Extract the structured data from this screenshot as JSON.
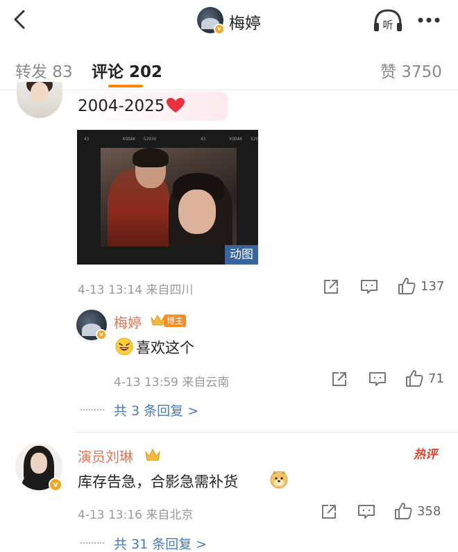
{
  "nav": {
    "title": "梅婷",
    "verified_badge": "v",
    "icons": [
      "back-arrow-icon",
      "listen-icon",
      "more-icon"
    ],
    "listen_label": "听"
  },
  "tabs": [
    {
      "label": "转发 83",
      "active": false
    },
    {
      "label": "评论 202",
      "active": true
    },
    {
      "label": "赞 3750",
      "active": false
    }
  ],
  "accent_color": "#ff8200",
  "comments": [
    {
      "text": "2004-2025",
      "gif": {
        "badge": "动图",
        "film_labels": [
          "43",
          "KODAK",
          "5293X",
          "43",
          "KODAK",
          "529"
        ]
      },
      "time": "4-13 13:14",
      "location": "来自四川",
      "likes": "137",
      "reply": {
        "author": "梅婷",
        "author_badge": "博主",
        "text": "喜欢这个",
        "time": "4-13 13:59",
        "location": "来自云南",
        "likes": "71"
      },
      "more_replies": "共 3 条回复 >"
    },
    {
      "author": "演员刘琳",
      "tag": "热评",
      "text": "库存告急，合影急需补货",
      "time": "4-13 13:16",
      "location": "来自北京",
      "likes": "358",
      "more_replies": "共 31 条回复 >"
    }
  ]
}
